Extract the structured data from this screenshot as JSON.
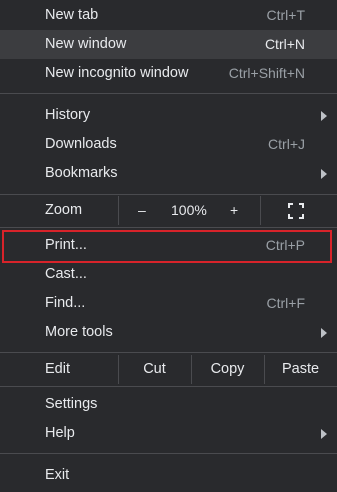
{
  "menu": {
    "new_tab": {
      "label": "New tab",
      "shortcut": "Ctrl+T"
    },
    "new_window": {
      "label": "New window",
      "shortcut": "Ctrl+N"
    },
    "new_incognito": {
      "label": "New incognito window",
      "shortcut": "Ctrl+Shift+N"
    },
    "history": {
      "label": "History"
    },
    "downloads": {
      "label": "Downloads",
      "shortcut": "Ctrl+J"
    },
    "bookmarks": {
      "label": "Bookmarks"
    },
    "zoom": {
      "label": "Zoom",
      "minus": "–",
      "value": "100%",
      "plus": "+",
      "fullscreen_icon": "fullscreen-icon"
    },
    "print": {
      "label": "Print...",
      "shortcut": "Ctrl+P"
    },
    "cast": {
      "label": "Cast..."
    },
    "find": {
      "label": "Find...",
      "shortcut": "Ctrl+F"
    },
    "more_tools": {
      "label": "More tools"
    },
    "edit": {
      "label": "Edit",
      "cut": "Cut",
      "copy": "Copy",
      "paste": "Paste"
    },
    "settings": {
      "label": "Settings"
    },
    "help": {
      "label": "Help"
    },
    "exit": {
      "label": "Exit"
    }
  },
  "colors": {
    "background": "#292a2d",
    "highlight": "#3c3d40",
    "annotation_box": "#d8232a"
  }
}
